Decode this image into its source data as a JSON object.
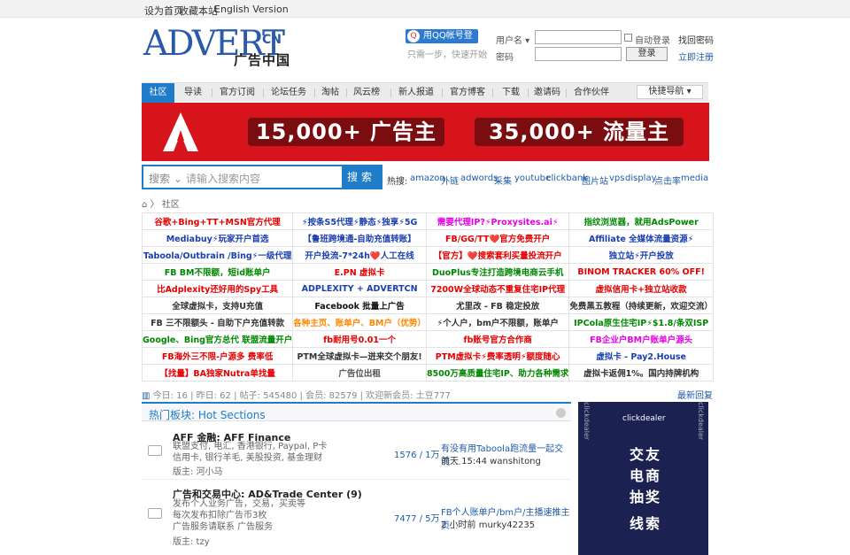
{
  "topbar": {
    "set_home": "设为首页",
    "favorite": "收藏本站",
    "english": "English Version"
  },
  "logo": {
    "adv": "ADVERT",
    "cn": "CN",
    "zh": "广告中国"
  },
  "login": {
    "qq_button": "用QQ帐号登录",
    "qq_hint": "只需一步，快速开始",
    "username_label": "用户名",
    "password_label": "密码",
    "auto_login": "自动登录",
    "login_button": "登录",
    "find_password": "找回密码",
    "register": "立即注册"
  },
  "nav": {
    "items": [
      "社区",
      "导读",
      "官方订阅",
      "论坛任务",
      "淘帖",
      "风云榜",
      "新人报道",
      "官方博客",
      "下载",
      "邀请码",
      "合作伙伴"
    ],
    "quick": "快捷导航"
  },
  "banner": {
    "left": "15,000+ 广告主",
    "right": "35,000+ 流量主"
  },
  "search": {
    "select": "搜索",
    "placeholder": "请输入搜索内容",
    "button": "搜索",
    "hot_label": "热搜:",
    "hot_terms": [
      "amazon",
      "外链",
      "adwords",
      "采集",
      "youtube",
      "clickbank",
      "图片站",
      "vps",
      "display",
      "点击率",
      "media"
    ]
  },
  "breadcrumb": {
    "home": "⌂",
    "item": "社区"
  },
  "ads": [
    [
      "谷歌+Bing+TT+MSN官方代理",
      "⚡按条S5代理⚡静态⚡独享⚡5G",
      "需要代理IP?⚡Proxysites.ai⚡",
      "指纹浏览器，就用AdsPower"
    ],
    [
      "Mediabuy⚡玩家开户首选",
      "【鲁班跨境通-自助充值转账】",
      "FB/GG/TT❤️官方免费开户",
      "Affiliate 全媒体流量资源⚡"
    ],
    [
      "Taboola/Outbrain /Bing⚡一级代理",
      "开户投流-7*24h❤️人工在线",
      "【官方】❤️搜索套利买量投流开户",
      "独立站⚡开户投放"
    ],
    [
      "FB BM不限额，短id账单户",
      "E.PN 虚拟卡",
      "DuoPlus专注打造跨境电商云手机",
      "BINOM TRACKER 60% OFF!"
    ],
    [
      "比Adplexity还好用的Spy工具",
      "ADPLEXITY + ADVERTCN",
      "7200W全球动态不重复住宅IP代理",
      "虚拟信用卡+独立站收款"
    ],
    [
      "全球虚拟卡，支持U充值",
      "Facebook 批量上广告",
      "尤里改 - FB 稳定投放",
      "免费黑五教程（持续更新，欢迎交流）"
    ],
    [
      "FB 三不限额头 - 自助下户充值转款",
      "各种主页、账单户、BM户（优势）",
      "⚡个人户，bm户不限额，账单户",
      "IPCola原生住宅IP⚡$1.8/条双ISP"
    ],
    [
      "Google、Bing官方总代 联盟流量开户",
      "fb耐用号0.01一个",
      "fb账号官方合作商",
      "FB企业户BM户账单户源头"
    ],
    [
      "FB海外三不限-户源多 费率低",
      "PTM全球虚拟卡—迸来交个朋友!",
      "PTM虚拟卡⚡费率透明⚡额度随心",
      "虚拟卡 - Pay2.House"
    ],
    [
      "【找量】BA独家Nutra单找量",
      "广告位出租",
      "8500万高质量住宅IP、助力各种需求",
      "虚拟卡返佣1%。国内持牌机构"
    ]
  ],
  "ad_colors": [
    [
      "#e60000",
      "#1a3fb0",
      "#e600e6",
      "#008800"
    ],
    [
      "#1a3fb0",
      "#1a3fb0",
      "#e60000",
      "#1a3fb0"
    ],
    [
      "#1a3fb0",
      "#1a3fb0",
      "#e60000",
      "#1a3fb0"
    ],
    [
      "#008800",
      "#e60000",
      "#008800",
      "#e60000"
    ],
    [
      "#e60000",
      "#1a3fb0",
      "#e60000",
      "#e60000"
    ],
    [
      "#333333",
      "#111111",
      "#333333",
      "#333333"
    ],
    [
      "#333333",
      "#ff8800",
      "#333333",
      "#008800"
    ],
    [
      "#008800",
      "#e60000",
      "#e60000",
      "#e600e6"
    ],
    [
      "#e60000",
      "#333333",
      "#e60000",
      "#1a3fb0"
    ],
    [
      "#e60000",
      "#555555",
      "#008800",
      "#333333"
    ]
  ],
  "stats": {
    "text": "今日: 16 | 昨日: 62 | 帖子: 545480 | 会员: 82579 | 欢迎新会员: 土豆777",
    "latest": "最新回复"
  },
  "forum_section": {
    "title": "热门板块: Hot Sections"
  },
  "forums": [
    {
      "title": "AFF 金融: AFF Finance",
      "desc": [
        "联盟支付, 电汇, 香港银行, Paypal, P卡",
        "信用卡, 银行羊毛, 美股投资, 基金理财"
      ],
      "mods": "版主: 河小马",
      "counts": "1576 / 1万",
      "last": "有没有用Taboola跑流量一起交流 ...",
      "last_time": "前天 15:44 wanshitong"
    },
    {
      "title": "广告和交易中心: AD&Trade Center (9)",
      "desc": [
        "发布个人业务广告，交易，买卖等",
        "每次发布扣除广告币3枚",
        "广告服务请联系 广告服务"
      ],
      "mods": "版主: tzy",
      "counts": "7477 / 5万",
      "last": "FB个人账单户/bm户/主播速推主页...",
      "last_time": "2 小时前 murky42235"
    }
  ],
  "side_ad": {
    "brand": "clickdealer",
    "lines": [
      "交友",
      "电商",
      "抽奖",
      "线索"
    ]
  }
}
